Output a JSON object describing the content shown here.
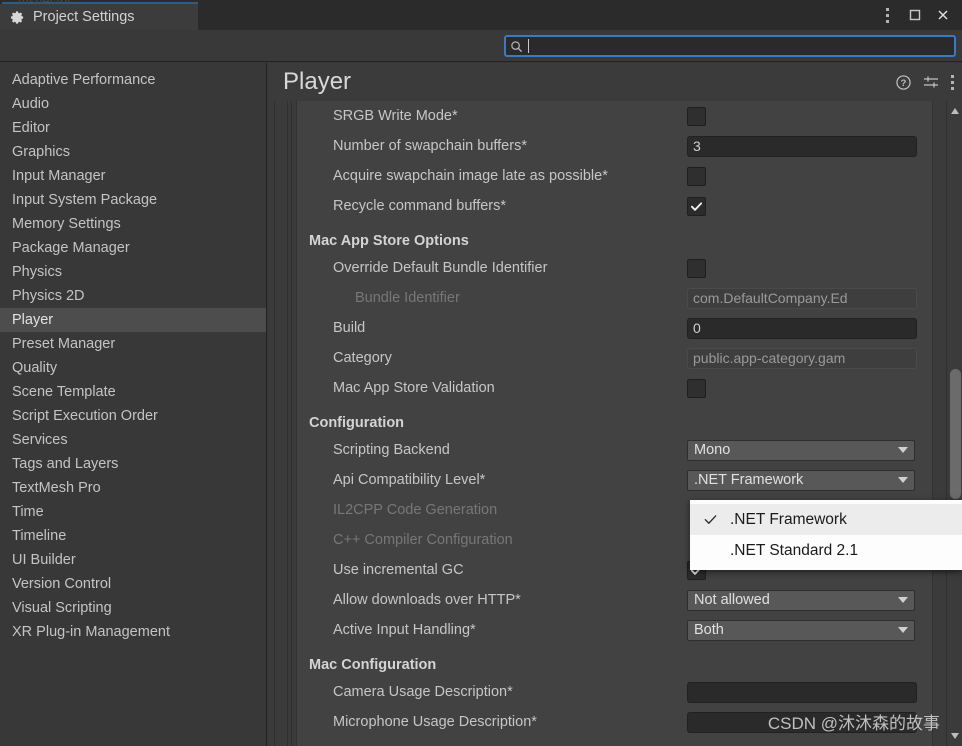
{
  "window": {
    "tab_label": "Project Settings",
    "tab_icon": "gear-icon",
    "ghost_text": "Inspector",
    "menu_icon": "kebab-menu-icon",
    "maximize_icon": "maximize-icon",
    "close_icon": "close-icon",
    "accent_color": "#2c5d87"
  },
  "search": {
    "icon": "search-icon",
    "value": "",
    "placeholder": "",
    "focused": true,
    "focus_color": "#3a79c4"
  },
  "sidebar": {
    "items": [
      {
        "label": "Adaptive Performance",
        "selected": false
      },
      {
        "label": "Audio",
        "selected": false
      },
      {
        "label": "Editor",
        "selected": false
      },
      {
        "label": "Graphics",
        "selected": false
      },
      {
        "label": "Input Manager",
        "selected": false
      },
      {
        "label": "Input System Package",
        "selected": false
      },
      {
        "label": "Memory Settings",
        "selected": false
      },
      {
        "label": "Package Manager",
        "selected": false
      },
      {
        "label": "Physics",
        "selected": false
      },
      {
        "label": "Physics 2D",
        "selected": false
      },
      {
        "label": "Player",
        "selected": true
      },
      {
        "label": "Preset Manager",
        "selected": false
      },
      {
        "label": "Quality",
        "selected": false
      },
      {
        "label": "Scene Template",
        "selected": false
      },
      {
        "label": "Script Execution Order",
        "selected": false
      },
      {
        "label": "Services",
        "selected": false
      },
      {
        "label": "Tags and Layers",
        "selected": false
      },
      {
        "label": "TextMesh Pro",
        "selected": false
      },
      {
        "label": "Time",
        "selected": false
      },
      {
        "label": "Timeline",
        "selected": false
      },
      {
        "label": "UI Builder",
        "selected": false
      },
      {
        "label": "Version Control",
        "selected": false
      },
      {
        "label": "Visual Scripting",
        "selected": false
      },
      {
        "label": "XR Plug-in Management",
        "selected": false
      }
    ]
  },
  "panel": {
    "title": "Player",
    "help_icon": "help-icon",
    "preset_icon": "preset-sliders-icon",
    "menu_icon": "kebab-menu-icon"
  },
  "rows": [
    {
      "type": "field",
      "label": "SRGB Write Mode*",
      "control": "checkbox",
      "checked": false,
      "indent": 1
    },
    {
      "type": "field",
      "label": "Number of swapchain buffers*",
      "control": "text",
      "value": "3",
      "indent": 1
    },
    {
      "type": "field",
      "label": "Acquire swapchain image late as possible*",
      "control": "checkbox",
      "checked": false,
      "indent": 1
    },
    {
      "type": "field",
      "label": "Recycle command buffers*",
      "control": "checkbox",
      "checked": true,
      "indent": 1
    },
    {
      "type": "section",
      "label": "Mac App Store Options"
    },
    {
      "type": "field",
      "label": "Override Default Bundle Identifier",
      "control": "checkbox",
      "checked": false,
      "indent": 1
    },
    {
      "type": "field",
      "label": "Bundle Identifier",
      "control": "text-readonly",
      "value": "com.DefaultCompany.Ed",
      "indent": 2,
      "disabled": true
    },
    {
      "type": "field",
      "label": "Build",
      "control": "text",
      "value": "0",
      "indent": 1
    },
    {
      "type": "field",
      "label": "Category",
      "control": "text-readonly",
      "value": "public.app-category.gam",
      "indent": 1
    },
    {
      "type": "field",
      "label": "Mac App Store Validation",
      "control": "checkbox",
      "checked": false,
      "indent": 1
    },
    {
      "type": "section",
      "label": "Configuration"
    },
    {
      "type": "field",
      "label": "Scripting Backend",
      "control": "dropdown",
      "value": "Mono",
      "indent": 1
    },
    {
      "type": "field",
      "label": "Api Compatibility Level*",
      "control": "dropdown",
      "value": ".NET Framework",
      "indent": 1
    },
    {
      "type": "field",
      "label": "IL2CPP Code Generation",
      "control": "none",
      "indent": 1,
      "disabled": true
    },
    {
      "type": "field",
      "label": "C++ Compiler Configuration",
      "control": "none",
      "indent": 1,
      "disabled": true
    },
    {
      "type": "field",
      "label": "Use incremental GC",
      "control": "checkbox",
      "checked": true,
      "indent": 1
    },
    {
      "type": "field",
      "label": "Allow downloads over HTTP*",
      "control": "dropdown",
      "value": "Not allowed",
      "indent": 1
    },
    {
      "type": "field",
      "label": "Active Input Handling*",
      "control": "dropdown",
      "value": "Both",
      "indent": 1
    },
    {
      "type": "section",
      "label": "Mac Configuration"
    },
    {
      "type": "field",
      "label": "Camera Usage Description*",
      "control": "text",
      "value": "",
      "indent": 1
    },
    {
      "type": "field",
      "label": "Microphone Usage Description*",
      "control": "text",
      "value": "",
      "indent": 1
    }
  ],
  "popup": {
    "open": true,
    "anchor_label": "Api Compatibility Level*",
    "items": [
      {
        "label": ".NET Framework",
        "checked": true
      },
      {
        "label": ".NET Standard 2.1",
        "checked": false
      }
    ]
  },
  "watermark": {
    "text": "CSDN @沐沐森的故事"
  },
  "scrollbar": {
    "up_arrow_icon": "triangle-up-icon",
    "down_arrow_icon": "triangle-down-icon",
    "thumb_position_pct": 42
  }
}
